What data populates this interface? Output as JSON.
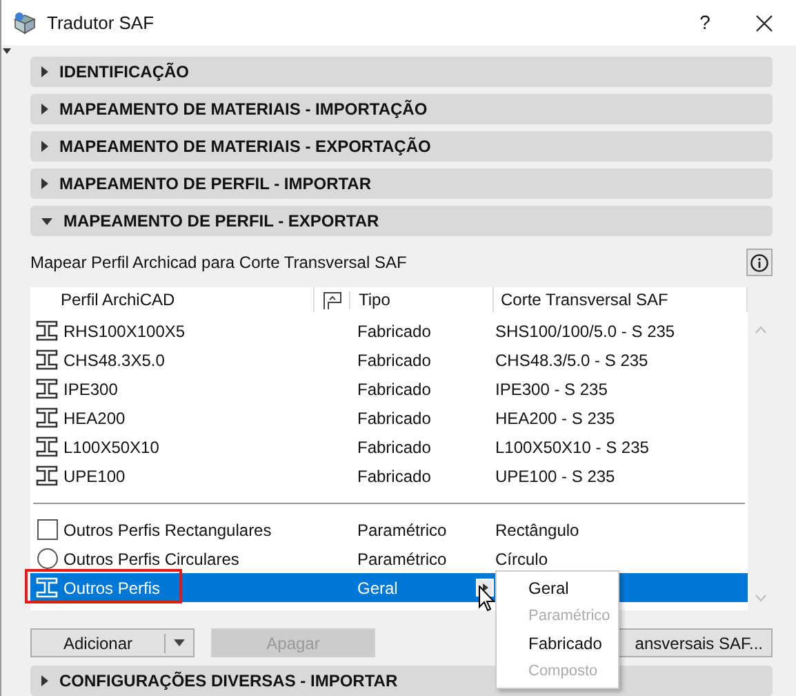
{
  "window": {
    "title": "Tradutor SAF",
    "help": "?"
  },
  "sections_top": [
    {
      "label": "IDENTIFICAÇÃO",
      "expanded": false
    },
    {
      "label": "MAPEAMENTO DE MATERIAIS - IMPORTAÇÃO",
      "expanded": false
    },
    {
      "label": "MAPEAMENTO DE MATERIAIS - EXPORTAÇÃO",
      "expanded": false
    },
    {
      "label": "MAPEAMENTO DE PERFIL - IMPORTAR",
      "expanded": false
    },
    {
      "label": "MAPEAMENTO DE PERFIL - EXPORTAR",
      "expanded": true
    }
  ],
  "caption": "Mapear Perfil Archicad para Corte Transversal SAF",
  "table": {
    "columns": [
      "Perfil ArchiCAD",
      "Tipo",
      "Corte Transversal SAF"
    ],
    "rows": [
      {
        "kind": "profile",
        "name": "RHS100X100X5",
        "type": "Fabricado",
        "saf": "SHS100/100/5.0 - S 235",
        "selected": false
      },
      {
        "kind": "profile",
        "name": "CHS48.3X5.0",
        "type": "Fabricado",
        "saf": "CHS48.3/5.0 - S 235",
        "selected": false
      },
      {
        "kind": "profile",
        "name": "IPE300",
        "type": "Fabricado",
        "saf": "IPE300 - S 235",
        "selected": false
      },
      {
        "kind": "profile",
        "name": "HEA200",
        "type": "Fabricado",
        "saf": "HEA200 - S 235",
        "selected": false
      },
      {
        "kind": "profile",
        "name": "L100X50X10",
        "type": "Fabricado",
        "saf": "L100X50X10 - S 235",
        "selected": false
      },
      {
        "kind": "profile",
        "name": "UPE100",
        "type": "Fabricado",
        "saf": "UPE100 - S 235",
        "selected": false
      }
    ],
    "other_rows": [
      {
        "kind": "rectangle",
        "name": "Outros Perfis Rectangulares",
        "type": "Paramétrico",
        "saf": "Rectângulo",
        "selected": false
      },
      {
        "kind": "circle",
        "name": "Outros Perfis Circulares",
        "type": "Paramétrico",
        "saf": "Círculo",
        "selected": false
      },
      {
        "kind": "profile",
        "name": "Outros Perfis",
        "type": "Geral",
        "saf": "",
        "selected": true
      }
    ]
  },
  "type_menu": [
    {
      "label": "Geral",
      "disabled": false
    },
    {
      "label": "Paramétrico",
      "disabled": true
    },
    {
      "label": "Fabricado",
      "disabled": false
    },
    {
      "label": "Composto",
      "disabled": true
    }
  ],
  "buttons": {
    "add": "Adicionar",
    "delete": "Apagar",
    "delete_disabled": true,
    "saf": "ansversais SAF..."
  },
  "sections_bottom": [
    {
      "label": "CONFIGURAÇÕES DIVERSAS - IMPORTAR",
      "expanded": false
    }
  ]
}
